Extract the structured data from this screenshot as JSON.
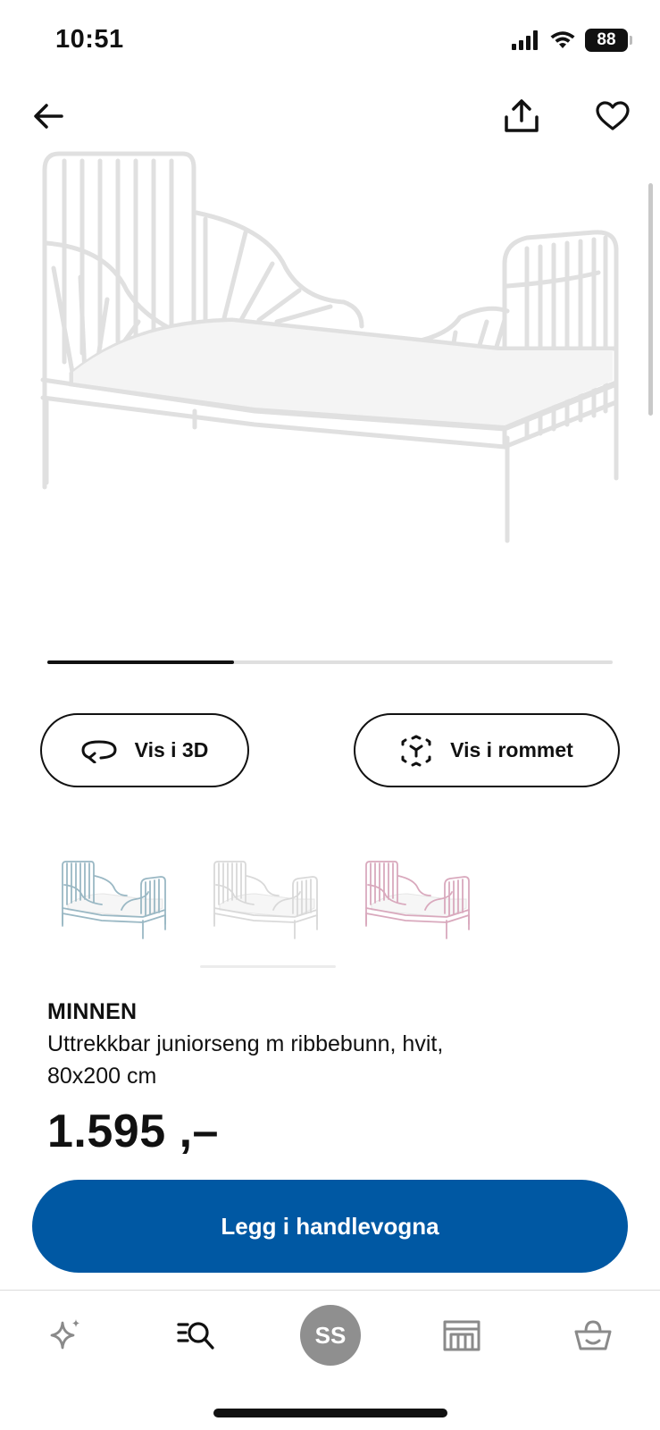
{
  "status_bar": {
    "time": "10:51",
    "battery": "88"
  },
  "gallery": {
    "progress_fraction": 0.33
  },
  "actions": {
    "view_3d_label": "Vis i 3D",
    "view_room_label": "Vis i rommet"
  },
  "variants": [
    {
      "color_name": "blue",
      "color": "#9ab8c4"
    },
    {
      "color_name": "white",
      "color": "#d9d9d9"
    },
    {
      "color_name": "pink",
      "color": "#d9a9bd"
    }
  ],
  "product": {
    "name": "MINNEN",
    "description_line1": "Uttrekkbar juniorseng m ribbebunn, hvit,",
    "description_line2": "80x200 cm",
    "price": "1.595 ,–"
  },
  "cart_button": {
    "label": "Legg i handlevogna",
    "color": "#0058a3"
  },
  "tab_bar": {
    "avatar_initials": "SS",
    "tabs": [
      "sparkle-icon",
      "search-list-icon",
      "avatar",
      "store-icon",
      "basket-icon"
    ]
  }
}
